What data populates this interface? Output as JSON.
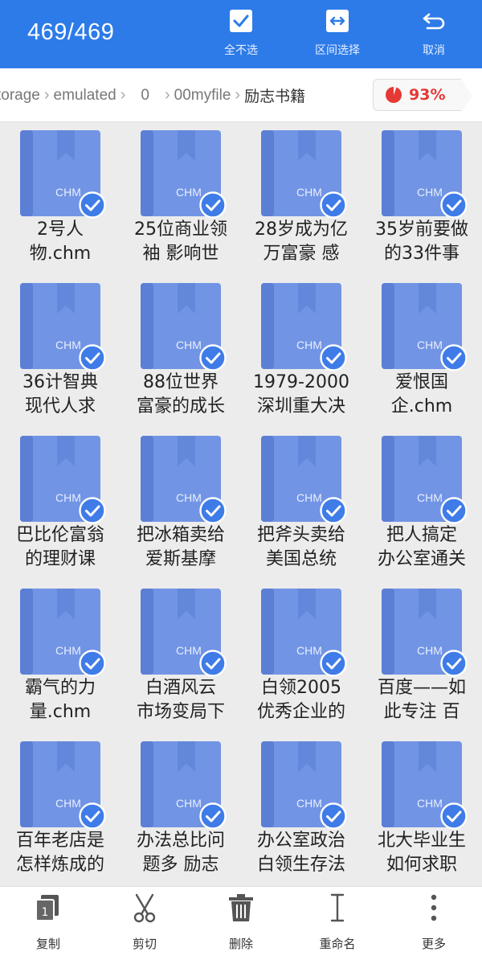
{
  "header": {
    "selection_count": "469/469",
    "actions": [
      {
        "label": "全不选",
        "icon": "checkbox-checked-icon"
      },
      {
        "label": "区间选择",
        "icon": "range-select-icon"
      },
      {
        "label": "取消",
        "icon": "cancel-return-icon"
      }
    ]
  },
  "breadcrumb": {
    "items": [
      "torage",
      "emulated",
      "0",
      "00myfile",
      "励志书籍"
    ],
    "storage_percent": "93%"
  },
  "files": [
    {
      "name": [
        "2号人",
        "物.chm"
      ],
      "badge": "CHM",
      "selected": true
    },
    {
      "name": [
        "25位商业领",
        "袖 影响世"
      ],
      "badge": "CHM",
      "selected": true
    },
    {
      "name": [
        "28岁成为亿",
        "万富豪 感"
      ],
      "badge": "CHM",
      "selected": true
    },
    {
      "name": [
        "35岁前要做",
        "的33件事"
      ],
      "badge": "CHM",
      "selected": true
    },
    {
      "name": [
        "36计智典",
        "现代人求"
      ],
      "badge": "CHM",
      "selected": true
    },
    {
      "name": [
        "88位世界",
        "富豪的成长"
      ],
      "badge": "CHM",
      "selected": true
    },
    {
      "name": [
        "1979-2000",
        "深圳重大决"
      ],
      "badge": "CHM",
      "selected": true
    },
    {
      "name": [
        "爱恨国",
        "企.chm"
      ],
      "badge": "CHM",
      "selected": true
    },
    {
      "name": [
        "巴比伦富翁",
        "的理财课"
      ],
      "badge": "CHM",
      "selected": true
    },
    {
      "name": [
        "把冰箱卖给",
        "爱斯基摩"
      ],
      "badge": "CHM",
      "selected": true
    },
    {
      "name": [
        "把斧头卖给",
        "美国总统"
      ],
      "badge": "CHM",
      "selected": true
    },
    {
      "name": [
        "把人搞定",
        "办公室通关"
      ],
      "badge": "CHM",
      "selected": true
    },
    {
      "name": [
        "霸气的力",
        "量.chm"
      ],
      "badge": "CHM",
      "selected": true
    },
    {
      "name": [
        "白酒风云",
        "市场变局下"
      ],
      "badge": "CHM",
      "selected": true
    },
    {
      "name": [
        "白领2005",
        "优秀企业的"
      ],
      "badge": "CHM",
      "selected": true
    },
    {
      "name": [
        "百度——如",
        "此专注 百"
      ],
      "badge": "CHM",
      "selected": true
    },
    {
      "name": [
        "百年老店是",
        "怎样炼成的"
      ],
      "badge": "CHM",
      "selected": true
    },
    {
      "name": [
        "办法总比问",
        "题多 励志"
      ],
      "badge": "CHM",
      "selected": true
    },
    {
      "name": [
        "办公室政治",
        "白领生存法"
      ],
      "badge": "CHM",
      "selected": true
    },
    {
      "name": [
        "北大毕业生",
        "如何求职"
      ],
      "badge": "CHM",
      "selected": true
    }
  ],
  "bottom_toolbar": [
    {
      "label": "复制",
      "icon": "copy-icon"
    },
    {
      "label": "剪切",
      "icon": "scissors-icon"
    },
    {
      "label": "删除",
      "icon": "trash-icon"
    },
    {
      "label": "重命名",
      "icon": "rename-cursor-icon"
    },
    {
      "label": "更多",
      "icon": "more-vertical-icon"
    }
  ],
  "colors": {
    "header_bg": "#2d7be8",
    "file_icon": "#7194e4",
    "file_icon_dark": "#5c7fd6",
    "check_badge": "#3f7ce8",
    "storage_warn": "#e53935"
  }
}
